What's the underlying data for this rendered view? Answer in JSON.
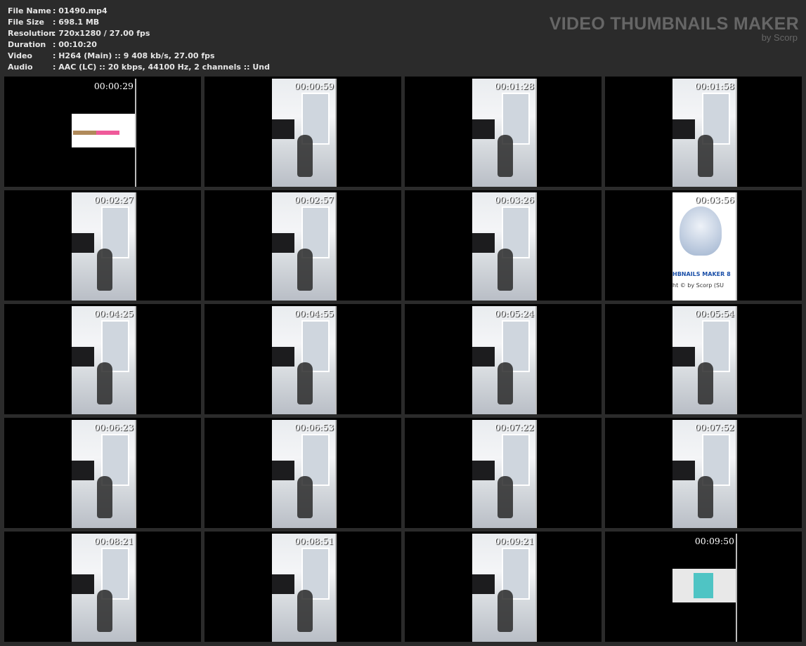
{
  "info": [
    {
      "key": "File Name",
      "value": ": 01490.mp4"
    },
    {
      "key": "File Size",
      "value": ": 698.1 MB"
    },
    {
      "key": "Resolution",
      "value": ": 720x1280 / 27.00 fps"
    },
    {
      "key": "Duration",
      "value": ": 00:10:20"
    },
    {
      "key": "Video",
      "value": ": H264 (Main) :: 9 408 kb/s, 27.00 fps"
    },
    {
      "key": "Audio",
      "value": ": AAC (LC) :: 20 kbps, 44100 Hz, 2 channels :: Und"
    }
  ],
  "watermark": {
    "title": "VIDEO THUMBNAILS MAKER",
    "by": "by Scorp"
  },
  "thumbnails": [
    "00:00:29",
    "00:00:59",
    "00:01:28",
    "00:01:58",
    "00:02:27",
    "00:02:57",
    "00:03:26",
    "00:03:56",
    "00:04:25",
    "00:04:55",
    "00:05:24",
    "00:05:54",
    "00:06:23",
    "00:06:53",
    "00:07:22",
    "00:07:52",
    "00:08:21",
    "00:08:51",
    "00:09:21",
    "00:09:50"
  ],
  "logo_frame": {
    "line1": "HBNAILS MAKER 8",
    "line2": "ht © by Scorp (SU"
  }
}
